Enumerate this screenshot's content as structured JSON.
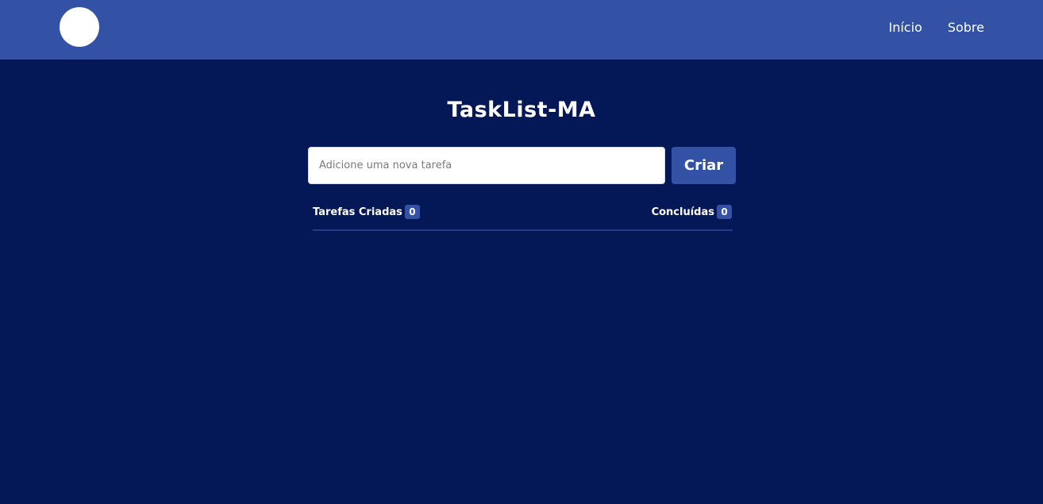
{
  "header": {
    "nav": [
      {
        "label": "Início"
      },
      {
        "label": "Sobre"
      }
    ]
  },
  "main": {
    "title": "TaskList-MA",
    "input": {
      "placeholder": "Adicione uma nova tarefa",
      "value": ""
    },
    "create_label": "Criar",
    "counters": {
      "created": {
        "label": "Tarefas Criadas",
        "count": "0"
      },
      "completed": {
        "label": "Concluídas",
        "count": "0"
      }
    }
  },
  "colors": {
    "background": "#041858",
    "header": "#3452a5",
    "accent": "#3452a5",
    "text": "#ffffff"
  }
}
